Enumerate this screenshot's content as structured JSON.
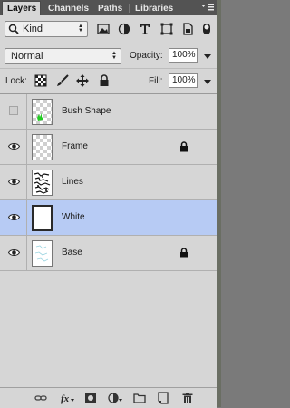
{
  "tabs": [
    {
      "label": "Layers",
      "active": true
    },
    {
      "label": "Channels",
      "active": false
    },
    {
      "label": "Paths",
      "active": false
    },
    {
      "label": "Libraries",
      "active": false
    }
  ],
  "filter": {
    "kind_label": "Kind"
  },
  "blend": {
    "mode": "Normal",
    "opacity_label": "Opacity:",
    "opacity_value": "100%"
  },
  "locks": {
    "lock_label": "Lock:",
    "fill_label": "Fill:",
    "fill_value": "100%"
  },
  "layers": [
    {
      "name": "Bush Shape",
      "visible": false,
      "locked": false,
      "selected": false
    },
    {
      "name": "Frame",
      "visible": true,
      "locked": true,
      "selected": false
    },
    {
      "name": "Lines",
      "visible": true,
      "locked": false,
      "selected": false
    },
    {
      "name": "White",
      "visible": true,
      "locked": false,
      "selected": true
    },
    {
      "name": "Base",
      "visible": true,
      "locked": true,
      "selected": false
    }
  ],
  "colors": {
    "selected_row": "#b7cbf4",
    "panel_bg": "#d6d6d6",
    "tab_bar": "#535353",
    "bush_green": "#22cc22"
  },
  "bottom_icons": [
    "link-layers-icon",
    "fx-icon",
    "add-mask-icon",
    "adjustment-layer-icon",
    "new-group-icon",
    "new-layer-icon",
    "delete-layer-icon"
  ]
}
